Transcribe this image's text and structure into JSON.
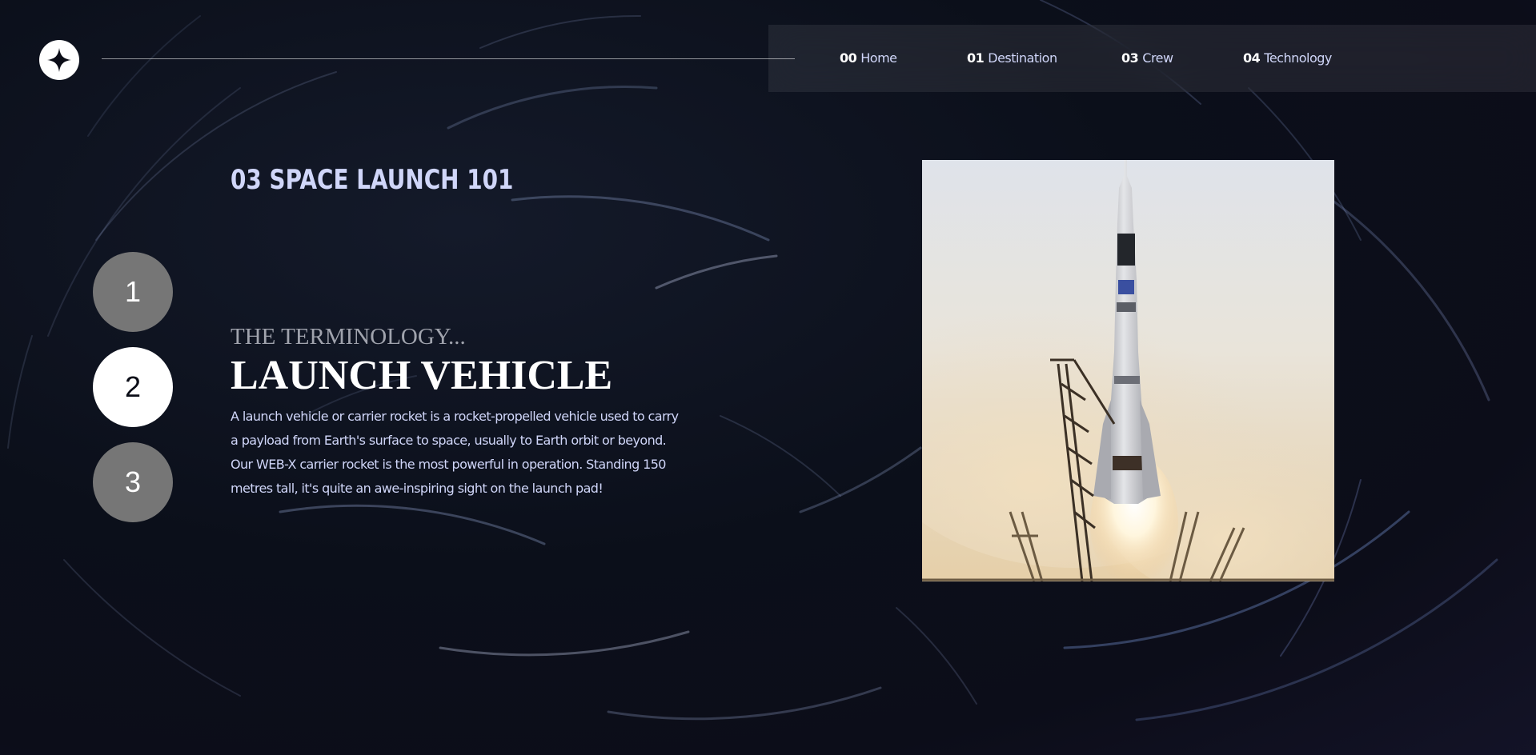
{
  "nav": {
    "items": [
      {
        "num": "00",
        "label": "Home"
      },
      {
        "num": "01",
        "label": "Destination"
      },
      {
        "num": "03",
        "label": "Crew"
      },
      {
        "num": "04",
        "label": "Technology"
      }
    ]
  },
  "page": {
    "eyebrow": "03 SPACE LAUNCH 101"
  },
  "stepper": {
    "steps": [
      "1",
      "2",
      "3"
    ],
    "active": "2"
  },
  "technology": {
    "terminology": "THE TERMINOLOGY...",
    "name": "LAUNCH VEHICLE",
    "description": "A launch vehicle or carrier rocket is a rocket-propelled vehicle used to carry a payload from Earth's surface to space, usually to Earth orbit or beyond. Our WEB-X carrier rocket is the most powerful in operation. Standing 150 metres tall, it's quite an awe-inspiring sight on the launch pad!"
  },
  "colors": {
    "background": "#0b0d17",
    "accent_text": "#d0d6f9",
    "step_inactive": "#767676",
    "step_active": "#ffffff"
  },
  "icons": {
    "logo": "four-point-star-logo-icon"
  }
}
